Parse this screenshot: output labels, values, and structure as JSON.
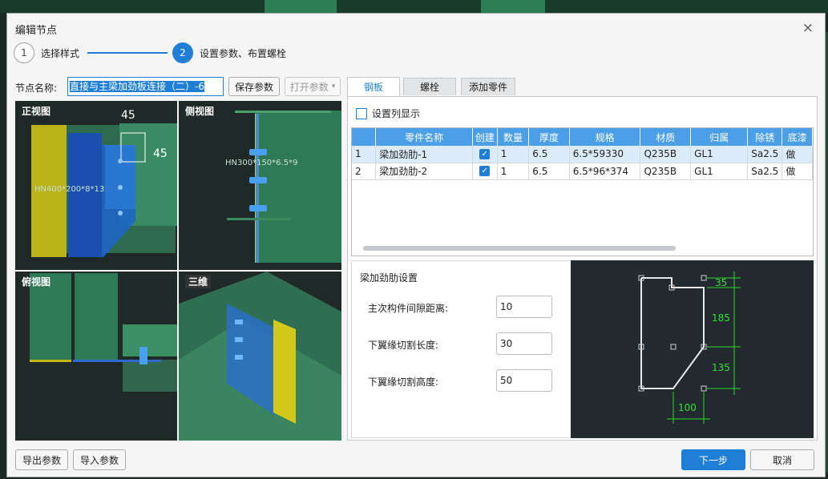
{
  "dialog": {
    "title": "编辑节点",
    "close_icon": "×"
  },
  "steps": [
    {
      "number": "1",
      "label": "选择样式",
      "active": false
    },
    {
      "number": "2",
      "label": "设置参数、布置螺栓",
      "active": true
    }
  ],
  "node_name": {
    "label": "节点名称:",
    "value": "直接与主梁加劲板连接（二）-6"
  },
  "toolbar": {
    "save": "保存参数",
    "open": "打开参数",
    "open_arrow": "▾"
  },
  "previews": {
    "front": {
      "label": "正视图",
      "beam": "HN400*200*8*13",
      "dim_top": "45",
      "dim_right": "45"
    },
    "side": {
      "label": "侧视图",
      "beam": "HN300*150*6.5*9"
    },
    "top": {
      "label": "俯视图"
    },
    "three_d": {
      "label": "三维"
    }
  },
  "tabs": [
    {
      "label": "钢板",
      "active": true
    },
    {
      "label": "螺栓",
      "active": false
    },
    {
      "label": "添加零件",
      "active": false
    }
  ],
  "set_columns_label": "设置列显示",
  "grid": {
    "headers": [
      "",
      "零件名称",
      "创建",
      "数量",
      "厚度",
      "规格",
      "材质",
      "归属",
      "除锈",
      "底漆"
    ],
    "rows": [
      {
        "index": "1",
        "name": "梁加劲肋-1",
        "create": true,
        "qty": "1",
        "thickness": "6.5",
        "spec": "6.5*59330",
        "material": "Q235B",
        "owner": "GL1",
        "rust": "Sa2.5",
        "primer": "做",
        "selected": true
      },
      {
        "index": "2",
        "name": "梁加劲肋-2",
        "create": true,
        "qty": "1",
        "thickness": "6.5",
        "spec": "6.5*96*374",
        "material": "Q235B",
        "owner": "GL1",
        "rust": "Sa2.5",
        "primer": "做",
        "selected": false
      }
    ]
  },
  "settings": {
    "title": "梁加劲肋设置",
    "fields": [
      {
        "label": "主次构件间隙距离:",
        "value": "10"
      },
      {
        "label": "下翼缘切割长度:",
        "value": "30"
      },
      {
        "label": "下翼缘切割高度:",
        "value": "50"
      }
    ]
  },
  "diagram": {
    "dim1": "35",
    "dim2": "185",
    "dim3": "135",
    "dim4": "100"
  },
  "footer": {
    "export": "导出参数",
    "import": "导入参数",
    "next": "下一步",
    "cancel": "取消"
  }
}
